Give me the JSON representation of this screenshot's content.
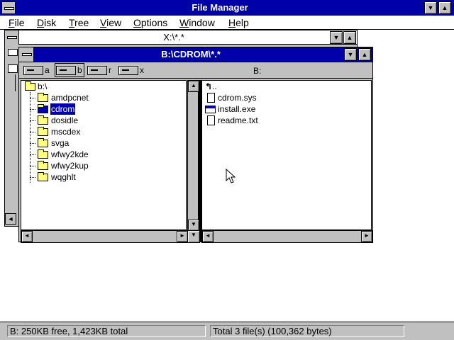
{
  "app": {
    "title": "File Manager",
    "minimize_glyph": "▼",
    "maximize_glyph": "▲"
  },
  "menubar": {
    "items": [
      {
        "hotkey": "F",
        "rest": "ile"
      },
      {
        "hotkey": "D",
        "rest": "isk"
      },
      {
        "hotkey": "T",
        "rest": "ree"
      },
      {
        "hotkey": "V",
        "rest": "iew"
      },
      {
        "hotkey": "O",
        "rest": "ptions"
      },
      {
        "hotkey": "W",
        "rest": "indow"
      },
      {
        "hotkey": "H",
        "rest": "elp"
      }
    ]
  },
  "background_window": {
    "title": "X:\\*.*"
  },
  "active_window": {
    "title": "B:\\CDROM\\*.*",
    "drives": [
      {
        "letter": "a"
      },
      {
        "letter": "b"
      },
      {
        "letter": "r"
      },
      {
        "letter": "x"
      }
    ],
    "volume_label": "B:",
    "tree": {
      "root": "b:\\",
      "folders": [
        "amdpcnet",
        "cdrom",
        "dosidle",
        "mscdex",
        "svga",
        "wfwy2kde",
        "wfwy2kup",
        "wqghlt"
      ],
      "selected": "cdrom"
    },
    "files": {
      "up_dir": "..",
      "items": [
        {
          "name": "cdrom.sys",
          "icon": "document-icon"
        },
        {
          "name": "install.exe",
          "icon": "program-icon"
        },
        {
          "name": "readme.txt",
          "icon": "text-document-icon"
        }
      ]
    },
    "scroll_glyphs": {
      "up": "▲",
      "down": "▼",
      "left": "◄",
      "right": "►"
    }
  },
  "status": {
    "drive_info": "B: 250KB free,  1,423KB total",
    "file_info": "Total 3 file(s) (100,362 bytes)"
  },
  "colors": {
    "active_title": "#0000a8",
    "chrome": "#c0c0c0",
    "folder": "#ffff80"
  }
}
